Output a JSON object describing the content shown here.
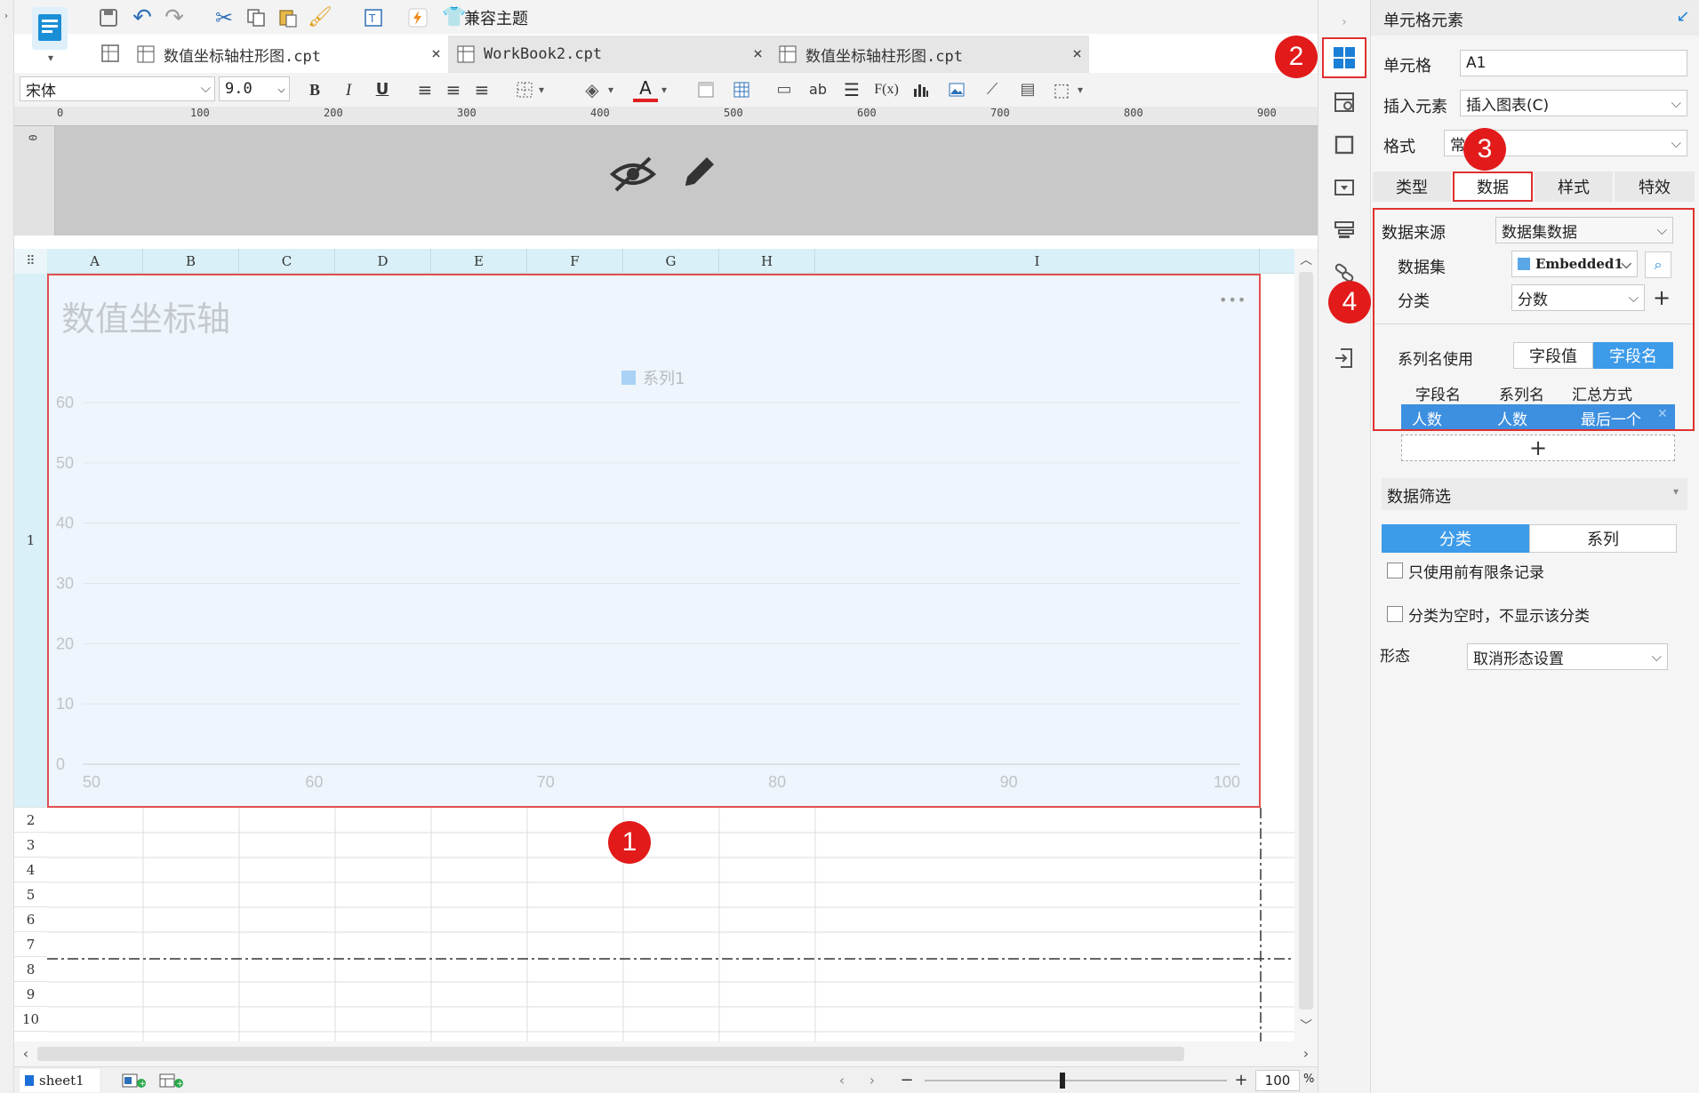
{
  "toolbar": {
    "theme_label": "兼容主题",
    "font_name": "宋体",
    "font_size": "9.0"
  },
  "tabs": [
    {
      "label": "数值坐标轴柱形图.cpt",
      "close": "×"
    },
    {
      "label": "WorkBook2.cpt",
      "close": "×"
    },
    {
      "label": "数值坐标轴柱形图.cpt",
      "close": "×"
    }
  ],
  "ruler": {
    "ticks": [
      "0",
      "100",
      "200",
      "300",
      "400",
      "500",
      "600",
      "700",
      "800",
      "900"
    ],
    "vtick": "0"
  },
  "grid": {
    "columns": [
      "A",
      "B",
      "C",
      "D",
      "E",
      "F",
      "G",
      "H",
      "I"
    ],
    "rows": [
      "1",
      "2",
      "3",
      "4",
      "5",
      "6",
      "7",
      "8",
      "9",
      "10"
    ]
  },
  "chart_data": {
    "type": "bar",
    "title": "数值坐标轴",
    "legend": "top-center",
    "series": [
      {
        "name": "系列1",
        "values": []
      }
    ],
    "xlim": [
      50,
      100
    ],
    "ylim": [
      0,
      60
    ],
    "x_ticks": [
      "50",
      "60",
      "70",
      "80",
      "90",
      "100"
    ],
    "y_ticks": [
      "60",
      "50",
      "40",
      "30",
      "20",
      "10",
      "0"
    ],
    "grid": true,
    "menu_glyph": "•••",
    "series_color": "#a9d2f5"
  },
  "sheet": {
    "name": "sheet1"
  },
  "zoom": {
    "minus": "−",
    "plus": "+",
    "value": "100",
    "unit": "%"
  },
  "panel": {
    "title": "单元格元素",
    "cell_label": "单元格",
    "cell_value": "A1",
    "insert_label": "插入元素",
    "insert_value": "插入图表(C)",
    "format_label": "格式",
    "format_value": "常",
    "tabs": [
      "类型",
      "数据",
      "样式",
      "特效"
    ],
    "data_source_label": "数据来源",
    "data_source_value": "数据集数据",
    "dataset_label": "数据集",
    "dataset_value": "Embedded1",
    "category_label": "分类",
    "category_value": "分数",
    "series_name_use_label": "系列名使用",
    "series_name_options": [
      "字段值",
      "字段名"
    ],
    "table_headers": [
      "字段名",
      "系列名",
      "汇总方式"
    ],
    "table_row": [
      "人数",
      "人数",
      "最后一个"
    ],
    "add_symbol": "+",
    "filter_label": "数据筛选",
    "filter_tabs": [
      "分类",
      "系列"
    ],
    "check1": "只使用前有限条记录",
    "check2": "分类为空时，不显示该分类",
    "shape_label": "形态",
    "shape_value": "取消形态设置"
  },
  "badges": [
    "1",
    "2",
    "3",
    "4"
  ]
}
